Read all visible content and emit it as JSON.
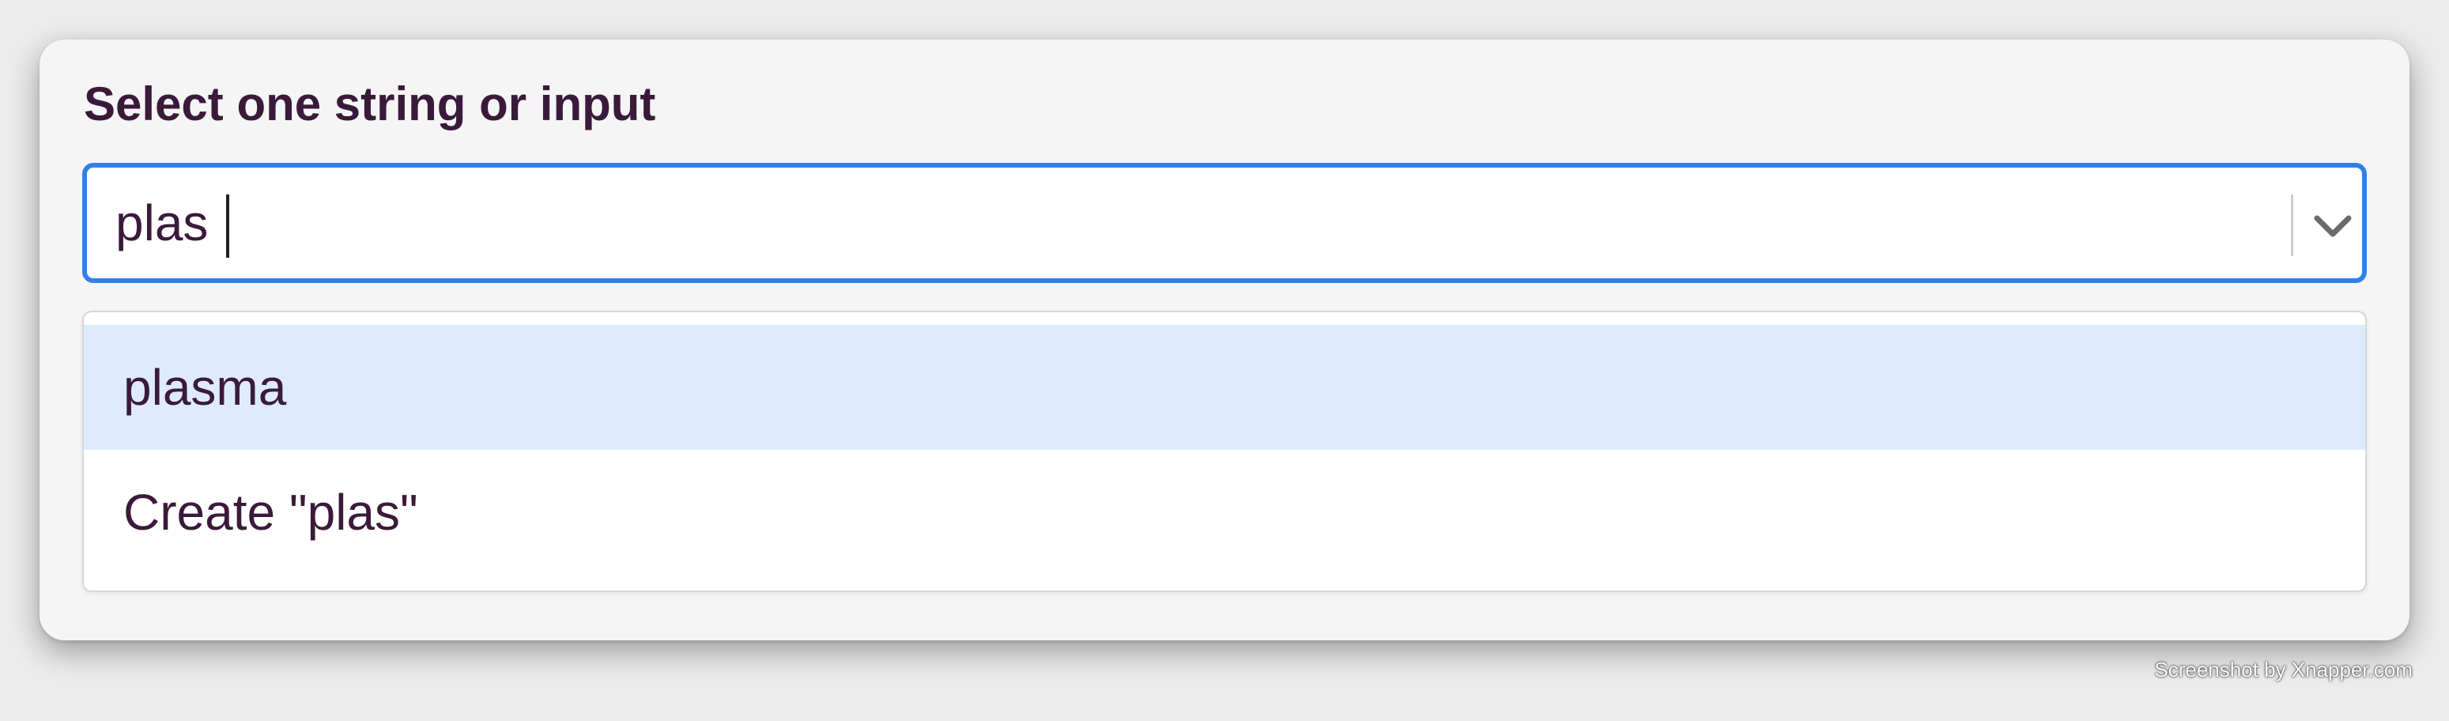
{
  "field": {
    "label": "Select one string or input",
    "input_value": "plas"
  },
  "menu": {
    "options": [
      {
        "label": "plasma",
        "focused": true
      },
      {
        "label": "Create \"plas\"",
        "focused": false
      }
    ]
  },
  "icons": {
    "dropdown": "chevron-down-icon"
  },
  "colors": {
    "focus_border": "#2f80ed",
    "focused_option_bg": "#deebfc",
    "text": "#3a1a3a"
  },
  "watermark": "Screenshot by Xnapper.com"
}
